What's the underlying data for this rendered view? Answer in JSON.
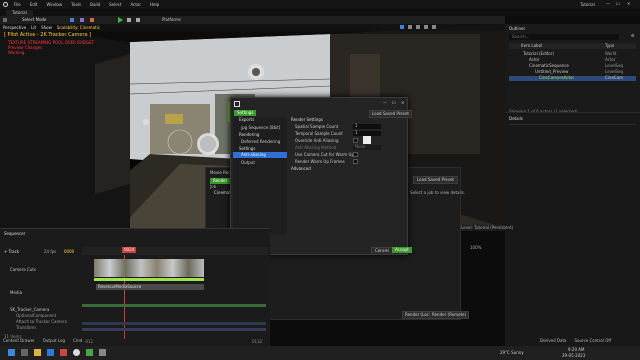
{
  "menu": {
    "items": [
      "File",
      "Edit",
      "Window",
      "Tools",
      "Build",
      "Select",
      "Actor",
      "Help"
    ],
    "project_tab": "Tutorial",
    "window_title": "Tutorial"
  },
  "toolbar": {
    "mode": "Select Mode",
    "platforms": "Platforms"
  },
  "viewport": {
    "modes": [
      "Perspective",
      "Lit",
      "Show",
      "Scalability: Cinematic"
    ],
    "pilot_text": "[ Pilot Active - 2K Tracker Camera ]",
    "warning_lines": [
      "TEXTURE STREAMING POOL OVER BUDGET",
      "Preview Changes",
      "Warning"
    ]
  },
  "outliner": {
    "tab": "Outliner",
    "search_placeholder": "Search...",
    "col_label": "Item Label",
    "col_type": "Type",
    "rows": [
      {
        "label": "Tutorial (Editor)",
        "type": "World"
      },
      {
        "label": "Actor",
        "type": "Actor"
      },
      {
        "label": "CinematicSequence",
        "type": "LevelSeq"
      },
      {
        "label": "Untitled_Preview",
        "type": "LevelSeq"
      },
      {
        "label": "CineCameraActor",
        "type": "CineCam"
      }
    ],
    "status": "Showing 1 of 6 actors (1 selected)"
  },
  "details": {
    "tab": "Details",
    "hint": "Select an object to view details."
  },
  "dialog": {
    "title": "Settings",
    "load_preset": "Load Saved Preset",
    "sidebar": [
      {
        "label": "Exports"
      },
      {
        "label": "jpg Sequence [8bit]"
      },
      {
        "label": "Rendering"
      },
      {
        "label": "Deferred Rendering"
      },
      {
        "label": "Settings"
      },
      {
        "label": "Anti-aliasing"
      },
      {
        "label": "Output"
      }
    ],
    "section": "Render Settings",
    "fields": [
      {
        "label": "Spatial Sample Count",
        "value": "1"
      },
      {
        "label": "Temporal Sample Count",
        "value": "1"
      },
      {
        "label": "Override Anti Aliasing",
        "value": ""
      },
      {
        "label": "Anti Aliasing Method",
        "value": "None"
      },
      {
        "label": "Use Camera Cut for Warm Up",
        "value": ""
      },
      {
        "label": "Render Warm Up Frames",
        "value": ""
      }
    ],
    "advanced": "Advanced",
    "cancel": "Cancel",
    "accept": "Accept"
  },
  "mrq": {
    "title": "Movie Render Queue",
    "render_btn": "Render",
    "job_label": "Job",
    "job_item": "CinematicSequence",
    "hint": "Select a job to view details.",
    "load_preset": "Load Saved Preset",
    "render_local": "Render (Local)",
    "render_remote": "Render (Remote)"
  },
  "sequencer": {
    "tab": "Sequencer",
    "track_btn": "+ Track",
    "fps": "24 fps",
    "frame": "0000",
    "playhead_label": "0024",
    "tracks": [
      "Camera Cuts",
      "Media",
      "SK_Tracker_Camera",
      "OptionalComponent",
      "Attach to Tracker Camera",
      "Transform"
    ],
    "clip_label": "RevenueMediaSource",
    "items_count": "11 items",
    "time_start": "-012",
    "time_end": "0132"
  },
  "level_bar": {
    "left": "Level: Tutorial (Persistent)",
    "zoom": "100%"
  },
  "taskbar": {
    "weather": "29°C Sunny",
    "time": "9:20 AM",
    "date": "29-05-2023"
  },
  "bottom_tabs": [
    "Content Drawer",
    "Output Log",
    "Cmd"
  ],
  "bottom_right": [
    "Derived Data",
    "Source Control Off"
  ],
  "colors": {
    "accent_blue": "#2f6fd6",
    "green": "#3b9a2d",
    "clip_green": "#9fe34b",
    "red_text": "#ff3b3b",
    "yellow_text": "#ffd23b",
    "timeline_red": "#c8423a"
  }
}
